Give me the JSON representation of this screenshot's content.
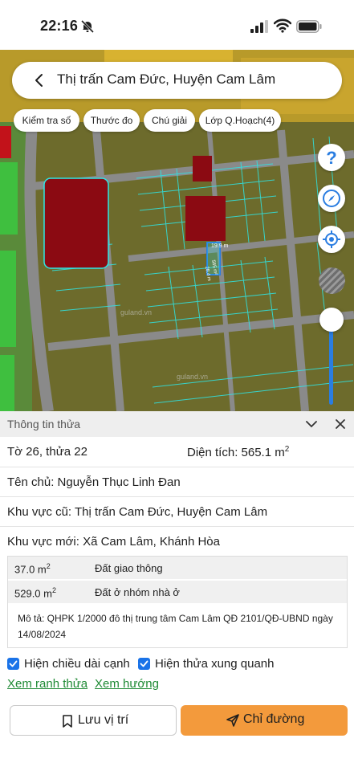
{
  "status_bar": {
    "time": "22:16",
    "icons": [
      "bell-slash-icon",
      "cellular-signal-icon",
      "wifi-icon",
      "battery-icon"
    ]
  },
  "search": {
    "title": "Thị trấn Cam Đức, Huyện Cam Lâm"
  },
  "chips": [
    {
      "label": "Kiểm tra số"
    },
    {
      "label": "Thước đo"
    },
    {
      "label": "Chú giải"
    },
    {
      "label": "Lớp Q.Hoạch(4)"
    }
  ],
  "map": {
    "controls": [
      "help-icon",
      "compass-icon",
      "locate-icon"
    ],
    "parcel_edge_top": "19.9 m",
    "parcel_edge_side": "28.4 m",
    "parcel_area": "565 m²",
    "watermark_1": "guland.vn",
    "watermark_2": "guland.vn",
    "colors": {
      "residential": "#6d6b2c",
      "commercial": "#8b0a12",
      "road": "#8a8a8a",
      "green": "#3fbf3f",
      "cyan_line": "#2ee6e6",
      "accent": "#2a7de1"
    }
  },
  "panel": {
    "title": "Thông tin thửa",
    "sheet_parcel": "Tờ 26, thửa 22",
    "area_label": "Diện tích: 565.1 m",
    "area_sup": "2",
    "owner": "Tên chủ: Nguyễn Thục Linh Đan",
    "old_area": "Khu vực cũ: Thị trấn Cam Đức, Huyện Cam Lâm",
    "new_area": "Khu vực mới: Xã Cam Lâm, Khánh Hòa",
    "zones": [
      {
        "size": "37.0 m",
        "sup": "2",
        "type": "Đất giao thông"
      },
      {
        "size": "529.0 m",
        "sup": "2",
        "type": "Đất ở nhóm nhà ở"
      }
    ],
    "description": "Mô tả: QHPK 1/2000 đô thị trung tâm Cam Lâm QĐ 2101/QĐ-UBND ngày 14/08/2024",
    "checkboxes": [
      {
        "label": "Hiện chiều dài cạnh",
        "checked": true
      },
      {
        "label": "Hiện thửa xung quanh",
        "checked": true
      }
    ],
    "links": {
      "boundary": "Xem ranh thửa",
      "direction": "Xem hướng"
    },
    "buttons": {
      "save": "Lưu vị trí",
      "route": "Chỉ đường"
    },
    "colors": {
      "route_button": "#f39a3c",
      "link": "#1f8a35",
      "checkbox": "#1a73e8"
    }
  }
}
